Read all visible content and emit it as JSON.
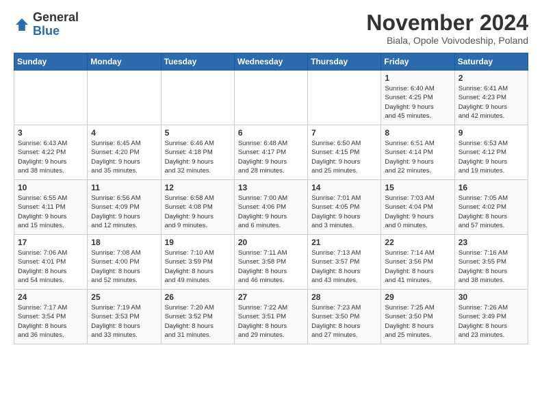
{
  "logo": {
    "general": "General",
    "blue": "Blue"
  },
  "title": "November 2024",
  "subtitle": "Biala, Opole Voivodeship, Poland",
  "headers": [
    "Sunday",
    "Monday",
    "Tuesday",
    "Wednesday",
    "Thursday",
    "Friday",
    "Saturday"
  ],
  "rows": [
    [
      {
        "day": "",
        "info": ""
      },
      {
        "day": "",
        "info": ""
      },
      {
        "day": "",
        "info": ""
      },
      {
        "day": "",
        "info": ""
      },
      {
        "day": "",
        "info": ""
      },
      {
        "day": "1",
        "info": "Sunrise: 6:40 AM\nSunset: 4:25 PM\nDaylight: 9 hours\nand 45 minutes."
      },
      {
        "day": "2",
        "info": "Sunrise: 6:41 AM\nSunset: 4:23 PM\nDaylight: 9 hours\nand 42 minutes."
      }
    ],
    [
      {
        "day": "3",
        "info": "Sunrise: 6:43 AM\nSunset: 4:22 PM\nDaylight: 9 hours\nand 38 minutes."
      },
      {
        "day": "4",
        "info": "Sunrise: 6:45 AM\nSunset: 4:20 PM\nDaylight: 9 hours\nand 35 minutes."
      },
      {
        "day": "5",
        "info": "Sunrise: 6:46 AM\nSunset: 4:18 PM\nDaylight: 9 hours\nand 32 minutes."
      },
      {
        "day": "6",
        "info": "Sunrise: 6:48 AM\nSunset: 4:17 PM\nDaylight: 9 hours\nand 28 minutes."
      },
      {
        "day": "7",
        "info": "Sunrise: 6:50 AM\nSunset: 4:15 PM\nDaylight: 9 hours\nand 25 minutes."
      },
      {
        "day": "8",
        "info": "Sunrise: 6:51 AM\nSunset: 4:14 PM\nDaylight: 9 hours\nand 22 minutes."
      },
      {
        "day": "9",
        "info": "Sunrise: 6:53 AM\nSunset: 4:12 PM\nDaylight: 9 hours\nand 19 minutes."
      }
    ],
    [
      {
        "day": "10",
        "info": "Sunrise: 6:55 AM\nSunset: 4:11 PM\nDaylight: 9 hours\nand 15 minutes."
      },
      {
        "day": "11",
        "info": "Sunrise: 6:56 AM\nSunset: 4:09 PM\nDaylight: 9 hours\nand 12 minutes."
      },
      {
        "day": "12",
        "info": "Sunrise: 6:58 AM\nSunset: 4:08 PM\nDaylight: 9 hours\nand 9 minutes."
      },
      {
        "day": "13",
        "info": "Sunrise: 7:00 AM\nSunset: 4:06 PM\nDaylight: 9 hours\nand 6 minutes."
      },
      {
        "day": "14",
        "info": "Sunrise: 7:01 AM\nSunset: 4:05 PM\nDaylight: 9 hours\nand 3 minutes."
      },
      {
        "day": "15",
        "info": "Sunrise: 7:03 AM\nSunset: 4:04 PM\nDaylight: 9 hours\nand 0 minutes."
      },
      {
        "day": "16",
        "info": "Sunrise: 7:05 AM\nSunset: 4:02 PM\nDaylight: 8 hours\nand 57 minutes."
      }
    ],
    [
      {
        "day": "17",
        "info": "Sunrise: 7:06 AM\nSunset: 4:01 PM\nDaylight: 8 hours\nand 54 minutes."
      },
      {
        "day": "18",
        "info": "Sunrise: 7:08 AM\nSunset: 4:00 PM\nDaylight: 8 hours\nand 52 minutes."
      },
      {
        "day": "19",
        "info": "Sunrise: 7:10 AM\nSunset: 3:59 PM\nDaylight: 8 hours\nand 49 minutes."
      },
      {
        "day": "20",
        "info": "Sunrise: 7:11 AM\nSunset: 3:58 PM\nDaylight: 8 hours\nand 46 minutes."
      },
      {
        "day": "21",
        "info": "Sunrise: 7:13 AM\nSunset: 3:57 PM\nDaylight: 8 hours\nand 43 minutes."
      },
      {
        "day": "22",
        "info": "Sunrise: 7:14 AM\nSunset: 3:56 PM\nDaylight: 8 hours\nand 41 minutes."
      },
      {
        "day": "23",
        "info": "Sunrise: 7:16 AM\nSunset: 3:55 PM\nDaylight: 8 hours\nand 38 minutes."
      }
    ],
    [
      {
        "day": "24",
        "info": "Sunrise: 7:17 AM\nSunset: 3:54 PM\nDaylight: 8 hours\nand 36 minutes."
      },
      {
        "day": "25",
        "info": "Sunrise: 7:19 AM\nSunset: 3:53 PM\nDaylight: 8 hours\nand 33 minutes."
      },
      {
        "day": "26",
        "info": "Sunrise: 7:20 AM\nSunset: 3:52 PM\nDaylight: 8 hours\nand 31 minutes."
      },
      {
        "day": "27",
        "info": "Sunrise: 7:22 AM\nSunset: 3:51 PM\nDaylight: 8 hours\nand 29 minutes."
      },
      {
        "day": "28",
        "info": "Sunrise: 7:23 AM\nSunset: 3:50 PM\nDaylight: 8 hours\nand 27 minutes."
      },
      {
        "day": "29",
        "info": "Sunrise: 7:25 AM\nSunset: 3:50 PM\nDaylight: 8 hours\nand 25 minutes."
      },
      {
        "day": "30",
        "info": "Sunrise: 7:26 AM\nSunset: 3:49 PM\nDaylight: 8 hours\nand 23 minutes."
      }
    ]
  ]
}
